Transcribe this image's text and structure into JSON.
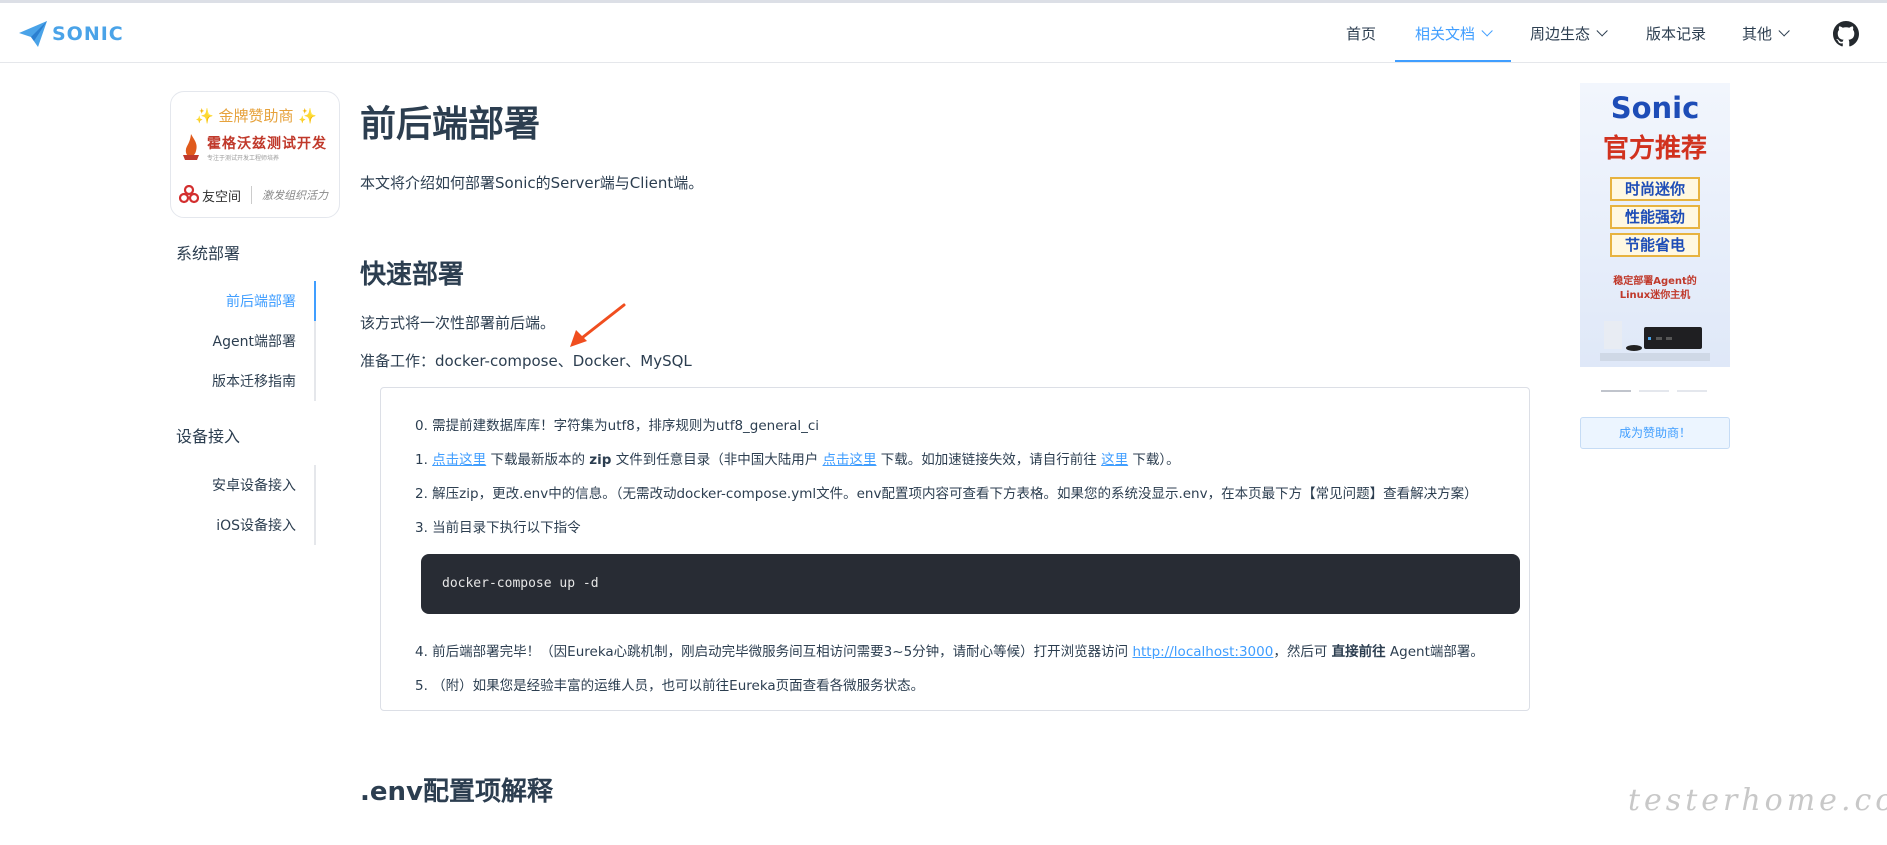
{
  "brand": {
    "name": "SONIC",
    "accent": "#409eff",
    "logo_color": "#4aa3e8"
  },
  "nav": {
    "items": [
      {
        "label": "首页",
        "has_dropdown": false,
        "active": false
      },
      {
        "label": "相关文档",
        "has_dropdown": true,
        "active": true
      },
      {
        "label": "周边生态",
        "has_dropdown": true,
        "active": false
      },
      {
        "label": "版本记录",
        "has_dropdown": false,
        "active": false
      },
      {
        "label": "其他",
        "has_dropdown": true,
        "active": false
      }
    ],
    "github_icon": "github-icon"
  },
  "sponsor": {
    "title": "✨ 金牌赞助商 ✨",
    "logo1_text": "霍格沃兹测试开发",
    "logo1_sub": "专注于测试开发工程师培养",
    "logo2_name": "友空间",
    "logo2_slogan": "激发组织活力"
  },
  "sidebar": {
    "groups": [
      {
        "title": "系统部署",
        "items": [
          {
            "label": "前后端部署",
            "active": true
          },
          {
            "label": "Agent端部署",
            "active": false
          },
          {
            "label": "版本迁移指南",
            "active": false
          }
        ]
      },
      {
        "title": "设备接入",
        "items": [
          {
            "label": "安卓设备接入",
            "active": false
          },
          {
            "label": "iOS设备接入",
            "active": false
          }
        ]
      }
    ]
  },
  "content": {
    "title": "前后端部署",
    "intro": "本文将介绍如何部署Sonic的Server端与Client端。",
    "quick_title": "快速部署",
    "quick_desc": "该方式将一次性部署前后端。",
    "prep": "准备工作：docker-compose、Docker、MySQL",
    "steps": {
      "s0": "0. 需提前建数据库库！字符集为utf8，排序规则为utf8_general_ci",
      "s1_prefix": "1. ",
      "s1_link1": "点击这里",
      "s1_mid1": " 下载最新版本的 ",
      "s1_bold": "zip",
      "s1_mid2": " 文件到任意目录（非中国大陆用户 ",
      "s1_link2": "点击这里",
      "s1_mid3": " 下载。如加速链接失效，请自行前往 ",
      "s1_link3": "这里",
      "s1_suffix": " 下载）。",
      "s2": "2. 解压zip，更改.env中的信息。（无需改动docker-compose.yml文件。env配置项内容可查看下方表格。如果您的系统没显示.env，在本页最下方【常见问题】查看解决方案）",
      "s3": "3. 当前目录下执行以下指令",
      "code": "docker-compose up -d",
      "s4_prefix": "4. 前后端部署完毕！（因Eureka心跳机制，刚启动完毕微服务间互相访问需要3~5分钟，请耐心等候）打开浏览器访问 ",
      "s4_link": "http://localhost:3000",
      "s4_mid": "，然后可 ",
      "s4_bold": "直接前往",
      "s4_suffix": " Agent端部署。",
      "s5": "5. （附）如果您是经验丰富的运维人员，也可以前往Eureka页面查看各微服务状态。"
    },
    "env_title": ".env配置项解释"
  },
  "ad": {
    "title1": "Sonic",
    "title2": "官方推荐",
    "tags": [
      "时尚迷你",
      "性能强劲",
      "节能省电"
    ],
    "note_line1": "稳定部署Agent的",
    "note_line2": "Linux迷你主机",
    "slide_count": 3,
    "active_slide": 1,
    "button": "成为赞助商！"
  },
  "watermark": "testerhome.com"
}
